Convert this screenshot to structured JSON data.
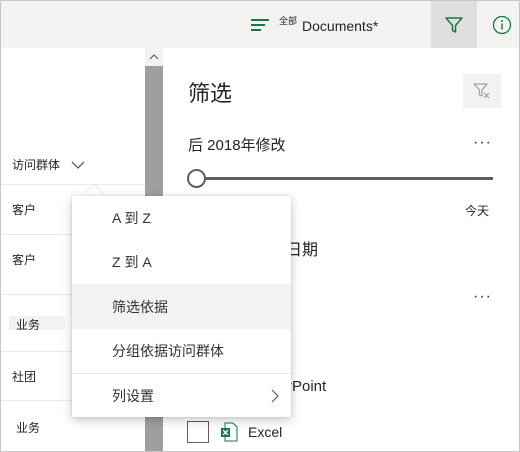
{
  "header": {
    "view_small": "全部",
    "view_title": "Documents*",
    "filter_icon": "filter-icon",
    "info_icon": "info-icon",
    "accent": "#107c41"
  },
  "left_list": {
    "group_header": "访问群体",
    "rows": [
      "客户",
      "客户",
      "业务",
      "社团",
      "业务"
    ]
  },
  "filter_pane": {
    "title": "筛选",
    "modified_section": "后 2018年修改",
    "more": "···",
    "slider_end": "今天",
    "date_label": "日期",
    "ppt_label": "rPoint",
    "excel_label": "Excel"
  },
  "context_menu": {
    "items": [
      "A 到 Z",
      "Z 到 A",
      "筛选依据",
      "分组依据访问群体",
      "列设置"
    ]
  }
}
